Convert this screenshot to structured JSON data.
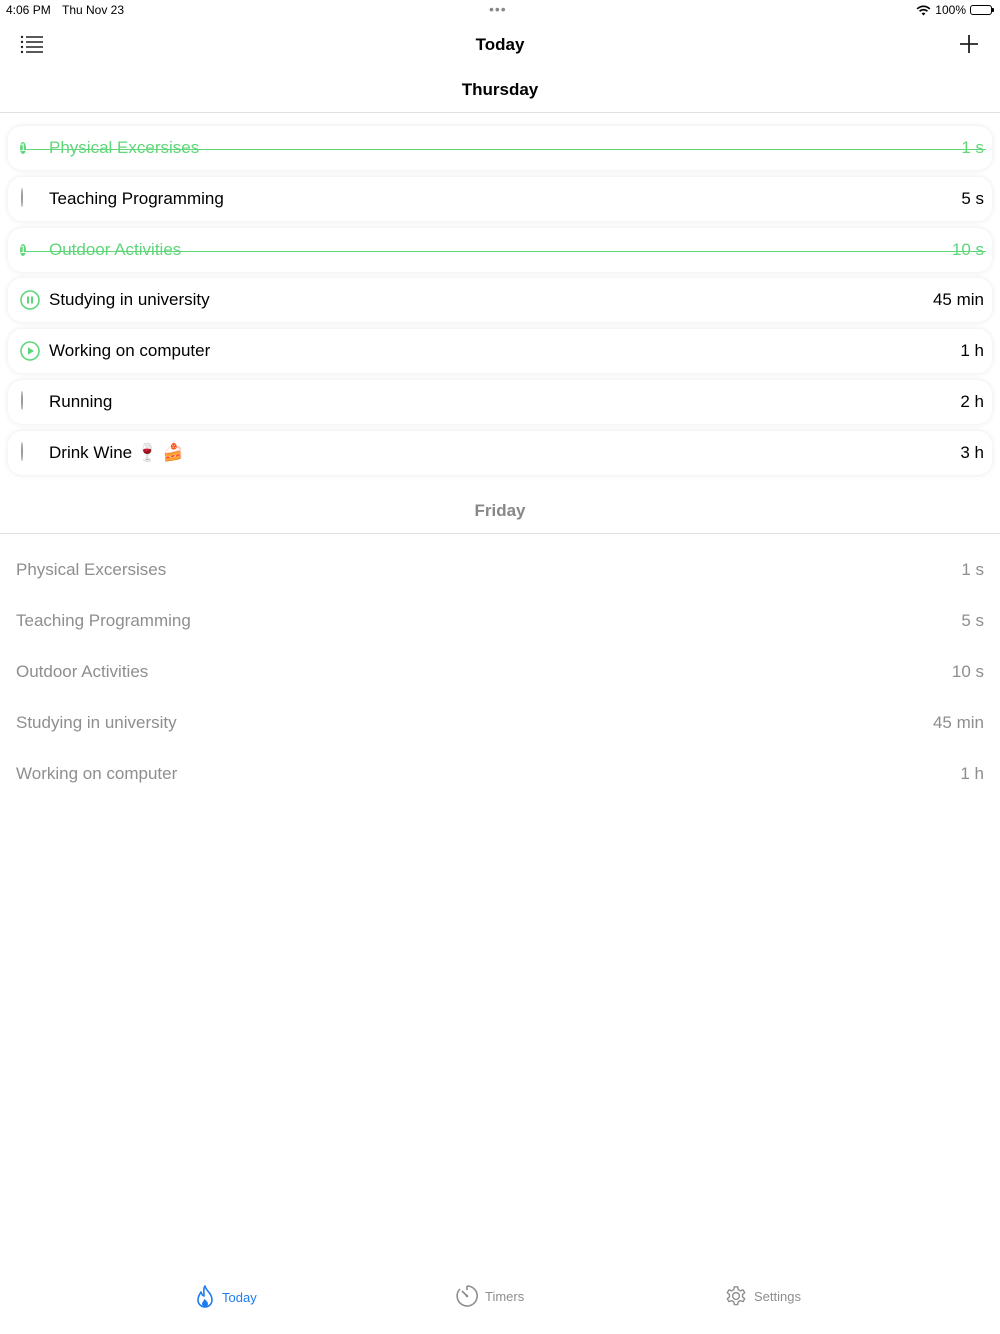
{
  "status_bar": {
    "time": "4:06 PM",
    "date": "Thu Nov 23",
    "dots": "•••",
    "battery_percent": "100%"
  },
  "nav": {
    "title": "Today",
    "menu_icon": "list-icon",
    "add_icon": "plus-icon"
  },
  "today_section": {
    "header": "Thursday",
    "items": [
      {
        "label": "Physical Excersises",
        "duration": "1 s",
        "state": "done",
        "count": "1"
      },
      {
        "label": "Teaching Programming",
        "duration": "5 s",
        "state": "idle"
      },
      {
        "label": "Outdoor Activities",
        "duration": "10 s",
        "state": "done",
        "count": "1"
      },
      {
        "label": "Studying in university",
        "duration": "45 min",
        "state": "paused"
      },
      {
        "label": "Working on computer",
        "duration": "1 h",
        "state": "playing"
      },
      {
        "label": "Running",
        "duration": "2 h",
        "state": "idle"
      },
      {
        "label": "Drink Wine 🍷 🍰",
        "duration": "3 h",
        "state": "idle"
      }
    ]
  },
  "tomorrow_section": {
    "header": "Friday",
    "items": [
      {
        "label": "Physical Excersises",
        "duration": "1 s"
      },
      {
        "label": "Teaching Programming",
        "duration": "5 s"
      },
      {
        "label": "Outdoor Activities",
        "duration": "10 s"
      },
      {
        "label": "Studying in university",
        "duration": "45 min"
      },
      {
        "label": "Working on computer",
        "duration": "1 h"
      }
    ]
  },
  "tabs": [
    {
      "label": "Today",
      "icon": "flame-icon",
      "active": true
    },
    {
      "label": "Timers",
      "icon": "timer-icon",
      "active": false
    },
    {
      "label": "Settings",
      "icon": "gear-icon",
      "active": false
    }
  ],
  "colors": {
    "accent_green": "#5fd67a",
    "accent_blue": "#1e7cf0",
    "muted": "#8e8e8e"
  }
}
